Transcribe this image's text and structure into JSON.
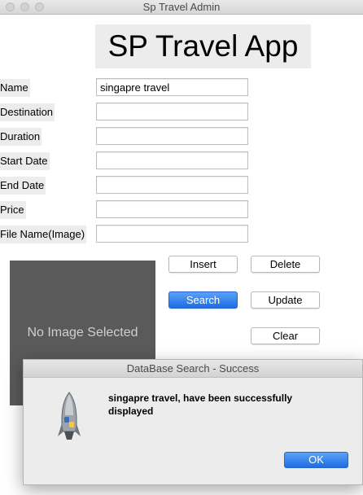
{
  "window": {
    "title": "Sp Travel Admin"
  },
  "app": {
    "heading": "SP Travel App"
  },
  "form": {
    "fields": [
      {
        "label": "Name",
        "value": "singapre travel"
      },
      {
        "label": "Destination",
        "value": ""
      },
      {
        "label": "Duration",
        "value": ""
      },
      {
        "label": "Start Date",
        "value": ""
      },
      {
        "label": "End Date",
        "value": ""
      },
      {
        "label": "Price",
        "value": ""
      },
      {
        "label": "File Name(Image)",
        "value": ""
      }
    ]
  },
  "image_panel": {
    "placeholder": "No Image Selected"
  },
  "buttons": {
    "insert": "Insert",
    "delete": "Delete",
    "search": "Search",
    "update": "Update",
    "clear": "Clear"
  },
  "dialog": {
    "title": "DataBase Search - Success",
    "message": "singapre travel, have been successfully displayed",
    "ok": "OK",
    "icon": "python-rocket-icon"
  },
  "colors": {
    "accent": "#1d6de5",
    "image_panel_bg": "#5a5a5a",
    "label_bg": "#ececec"
  }
}
